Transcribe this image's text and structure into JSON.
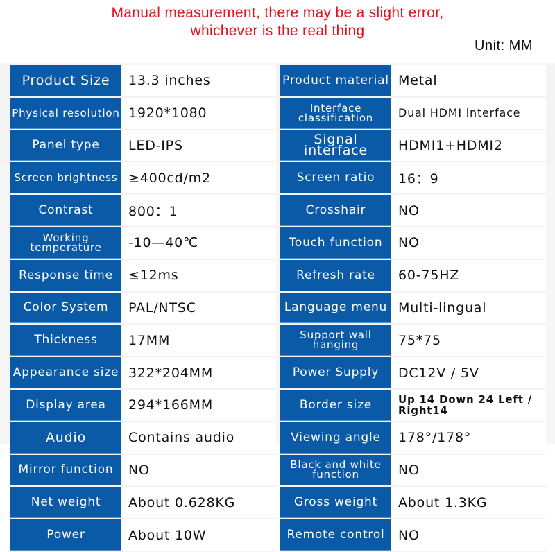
{
  "header": {
    "note_line1": "Manual measurement, there may be a slight error,",
    "note_line2": "whichever is the real thing",
    "unit": "Unit: MM"
  },
  "colors": {
    "note": "#e0141e",
    "label_bg": "#0a5aa8",
    "label_text": "#ffffff",
    "value_text": "#111111"
  },
  "left_specs": [
    {
      "label": "Product Size",
      "value": "13.3 inches"
    },
    {
      "label": "Physical resolution",
      "value": "1920*1080"
    },
    {
      "label": "Panel type",
      "value": "LED-IPS"
    },
    {
      "label": "Screen brightness",
      "value": "≥400cd/m2"
    },
    {
      "label": "Contrast",
      "value": "800：1"
    },
    {
      "label": "Working temperature",
      "value": "-10—40℃"
    },
    {
      "label": "Response time",
      "value": "≤12ms"
    },
    {
      "label": "Color System",
      "value": "PAL/NTSC"
    },
    {
      "label": "Thickness",
      "value": "17MM"
    },
    {
      "label": "Appearance size",
      "value": "322*204MM"
    },
    {
      "label": "Display area",
      "value": "294*166MM"
    },
    {
      "label": "Audio",
      "value": "Contains audio"
    },
    {
      "label": "Mirror function",
      "value": "NO"
    },
    {
      "label": "Net weight",
      "value": "About 0.628KG"
    },
    {
      "label": "Power",
      "value": "About 10W"
    }
  ],
  "right_specs": [
    {
      "label": "Product material",
      "value": "Metal"
    },
    {
      "label": "Interface classification",
      "value": "Dual HDMI interface"
    },
    {
      "label": "Signal interface",
      "value": "HDMI1+HDMI2"
    },
    {
      "label": "Screen ratio",
      "value": "16：9"
    },
    {
      "label": "Crosshair",
      "value": "NO"
    },
    {
      "label": "Touch function",
      "value": "NO"
    },
    {
      "label": "Refresh rate",
      "value": "60-75HZ"
    },
    {
      "label": "Language menu",
      "value": "Multi-lingual"
    },
    {
      "label": "Support wall hanging",
      "value": "75*75"
    },
    {
      "label": "Power Supply",
      "value": "DC12V / 5V"
    },
    {
      "label": "Border size",
      "value": "Up 14  Down 24 Left / Right14"
    },
    {
      "label": "Viewing angle",
      "value": "178°/178°"
    },
    {
      "label": "Black and white function",
      "value": "NO"
    },
    {
      "label": "Gross weight",
      "value": "About 1.3KG"
    },
    {
      "label": "Remote control",
      "value": "NO"
    }
  ]
}
